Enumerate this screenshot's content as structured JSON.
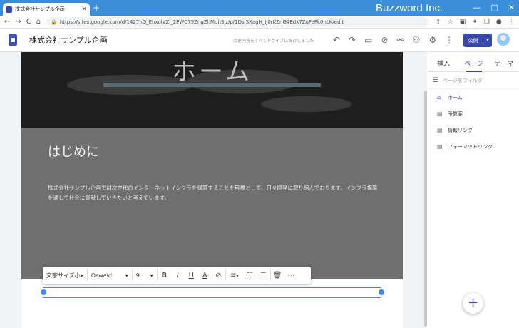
{
  "browser": {
    "tab_title": "株式会社サンプル企画",
    "tab_close": "×",
    "new_tab": "+",
    "url": "https://sites.google.com/d/1427hG_EhxolVZl_2PWC75ZngZhMdh3lz/p/1DslSXagH_iJ0rKZnG4EdxTZqFeFk0hLK/edit",
    "brand": "Buzzword Inc.",
    "win_min": "—",
    "win_max": "□",
    "win_close": "✕",
    "nav": [
      "←",
      "→",
      "C",
      "⌂"
    ],
    "ext_icons": [
      "⇪",
      "☆",
      "▣",
      "✦",
      "❐",
      "●",
      "⋮"
    ]
  },
  "app": {
    "site_name": "株式会社サンプル企画",
    "saved_status": "変更内容をすべてドライブに保存しました",
    "tool_icons": [
      "↶",
      "↷",
      "▭",
      "⊘",
      "⚯",
      "⚇",
      "⚙",
      "⋮"
    ],
    "publish_label": "公開",
    "publish_dropdown": "▾"
  },
  "page": {
    "header_title": "ホーム",
    "section_title": "はじめに",
    "section_body": "株式会社サンプル企画では次世代のインターネットインフラを構築することを目標として、日々開発に取り組んでおります。インフラ構築を通して社会に貢献していきたいと考えています。"
  },
  "toolbar": {
    "text_style": "文字サイズ小",
    "font": "Oswald",
    "size": "9",
    "bold": "B",
    "italic": "I",
    "underline": "U",
    "text_color": "A",
    "link": "⊘",
    "align": "≡",
    "bullets": "☰",
    "numbers": "☷",
    "delete": "🗑",
    "more": "⋯",
    "arrow": "▾"
  },
  "panel": {
    "tabs": [
      "挿入",
      "ページ",
      "テーマ"
    ],
    "filter_placeholder": "ページをフィルタ",
    "pages": [
      {
        "label": "ホーム",
        "icon": "⌂"
      },
      {
        "label": "予算案",
        "icon": "▤"
      },
      {
        "label": "情報リンク",
        "icon": "▤"
      },
      {
        "label": "フォーマットリンク",
        "icon": "▤"
      }
    ],
    "fab": "+"
  }
}
